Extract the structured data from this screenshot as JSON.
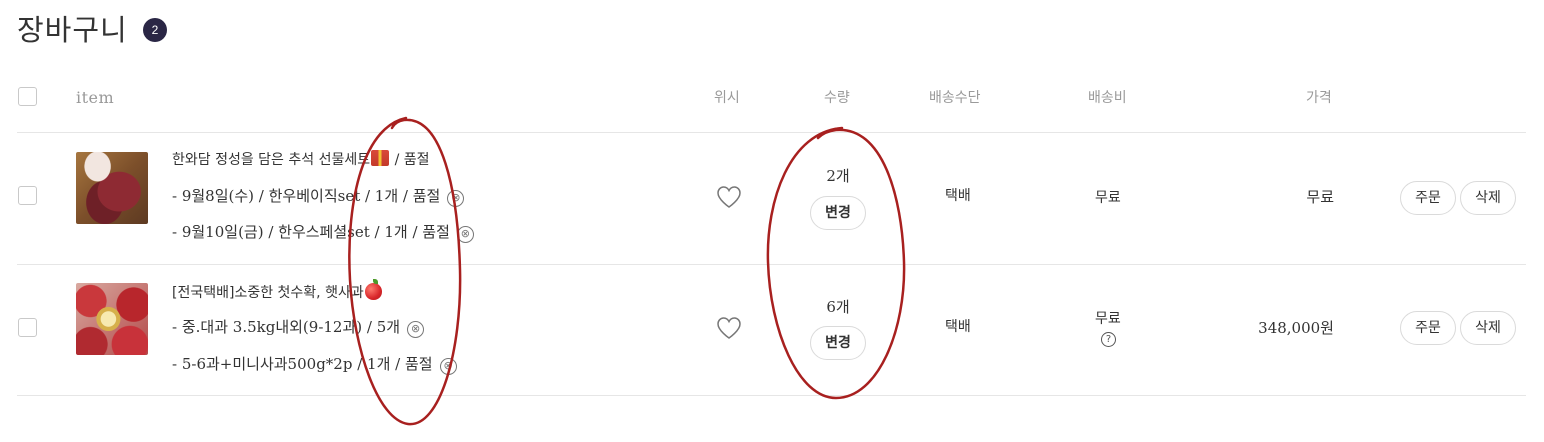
{
  "cart": {
    "title": "장바구니",
    "count": "2"
  },
  "table_header": {
    "item": "item",
    "wish": "위시",
    "quantity": "수량",
    "shipping_method": "배송수단",
    "shipping_fee": "배송비",
    "price": "가격"
  },
  "rows": [
    {
      "name_before": "한와담 정성을 담은 추석 선물세트",
      "name_emoji": "gift-icon",
      "name_after": " / 품절",
      "options": [
        "- 9월8일(수) / 한우베이직set / 1개 / 품절",
        "- 9월10일(금) / 한우스페셜set / 1개 / 품절"
      ],
      "quantity": "2개",
      "change_label": "변경",
      "shipping_method": "택배",
      "shipping_fee": "무료",
      "price": "무료",
      "order_label": "주문",
      "delete_label": "삭제"
    },
    {
      "name_before": "[전국택배]소중한 첫수확, 햇사과",
      "name_emoji": "apple-icon",
      "name_after": "",
      "options": [
        "- 중.대과 3.5kg내외(9-12과) / 5개",
        "- 5-6과+미니사과500g*2p / 1개 / 품절"
      ],
      "quantity": "6개",
      "change_label": "변경",
      "shipping_method": "택배",
      "shipping_fee": "무료",
      "shipping_fee_help": "?",
      "price": "348,000원",
      "order_label": "주문",
      "delete_label": "삭제"
    }
  ],
  "remove_option_icon": "⊗",
  "colors": {
    "badge_bg": "#2a2645",
    "annotation_red": "#a8201f",
    "divider": "#e6e6e6"
  }
}
